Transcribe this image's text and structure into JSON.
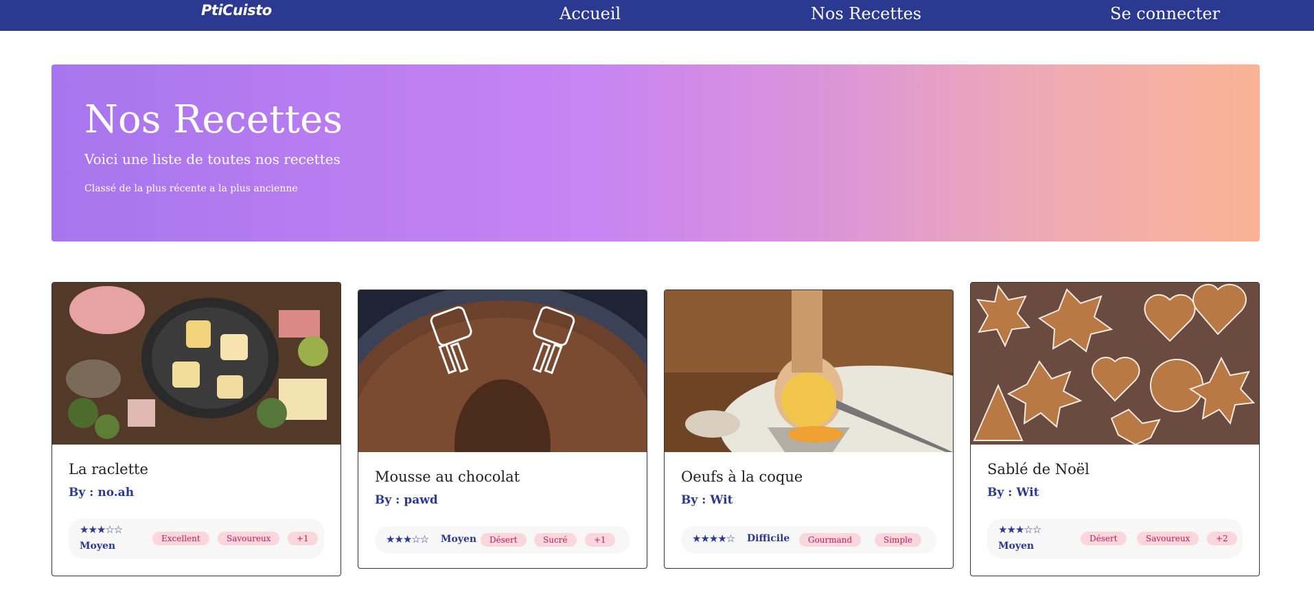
{
  "nav": {
    "brand": "PtiCuisto",
    "links": [
      "Accueil",
      "Nos Recettes",
      "Se connecter"
    ]
  },
  "hero": {
    "title": "Nos Recettes",
    "subtitle": "Voici une liste de toutes nos recettes",
    "note": "Classé de la plus récente a la plus ancienne"
  },
  "cards": [
    {
      "title": "La raclette",
      "author": "By : no.ah",
      "rating": 3,
      "stars": "★★★☆☆",
      "level": "Moyen",
      "tags": [
        "Excellent",
        "Savoureux",
        "+1"
      ],
      "image": "raclette-photo"
    },
    {
      "title": "Mousse au chocolat",
      "author": "By : pawd",
      "rating": 3,
      "stars": "★★★☆☆",
      "level": "Moyen",
      "tags": [
        "Désert",
        "Sucré",
        "+1"
      ],
      "image": "chocolate-mousse-photo"
    },
    {
      "title": "Oeufs à la coque",
      "author": "By : Wit",
      "rating": 4,
      "stars": "★★★★☆",
      "level": "Difficile",
      "tags": [
        "Gourmand",
        "Simple"
      ],
      "image": "boiled-egg-photo"
    },
    {
      "title": "Sablé de Noël",
      "author": "By : Wit",
      "rating": 3,
      "stars": "★★★☆☆",
      "level": "Moyen",
      "tags": [
        "Désert",
        "Savoureux",
        "+2"
      ],
      "image": "christmas-cookies-photo"
    }
  ],
  "colors": {
    "navbar": "#2b3990",
    "accent": "#2b3990",
    "tag_bg": "#f9d7dc",
    "tag_text": "#c2185b"
  }
}
